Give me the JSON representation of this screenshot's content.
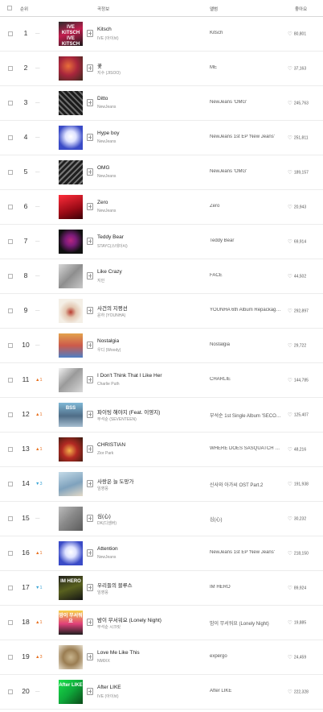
{
  "header": {
    "rank": "순위",
    "song_info": "곡정보",
    "album": "앨범",
    "like": "좋아요"
  },
  "rows": [
    {
      "rank": "1",
      "change": "—",
      "title": "Kitsch",
      "artist": "IVE (아이브)",
      "album": "Kitsch",
      "likes": "80,801",
      "cover_text": "IVE KITSCH IVE KITSCH IVE"
    },
    {
      "rank": "2",
      "change": "—",
      "title": "꽃",
      "artist": "지수 (JISOO)",
      "album": "ME",
      "likes": "37,163",
      "cover_text": ""
    },
    {
      "rank": "3",
      "change": "—",
      "title": "Ditto",
      "artist": "NewJeans",
      "album": "NewJeans 'OMG'",
      "likes": "245,763",
      "cover_text": ""
    },
    {
      "rank": "4",
      "change": "—",
      "title": "Hype boy",
      "artist": "NewJeans",
      "album": "NewJeans 1st EP 'New Jeans'",
      "likes": "251,811",
      "cover_text": ""
    },
    {
      "rank": "5",
      "change": "—",
      "title": "OMG",
      "artist": "NewJeans",
      "album": "NewJeans 'OMG'",
      "likes": "189,157",
      "cover_text": ""
    },
    {
      "rank": "6",
      "change": "—",
      "title": "Zero",
      "artist": "NewJeans",
      "album": "Zero",
      "likes": "20,943",
      "cover_text": ""
    },
    {
      "rank": "7",
      "change": "—",
      "title": "Teddy Bear",
      "artist": "STAYC(스테이씨)",
      "album": "Teddy Bear",
      "likes": "69,914",
      "cover_text": ""
    },
    {
      "rank": "8",
      "change": "—",
      "title": "Like Crazy",
      "artist": "지민",
      "album": "FACE",
      "likes": "44,502",
      "cover_text": ""
    },
    {
      "rank": "9",
      "change": "—",
      "title": "사건의 지평선",
      "artist": "윤하 (YOUNHA)",
      "album": "YOUNHA 6th Album Repackage 'END THEORY : Final Edition'",
      "likes": "292,897",
      "cover_text": ""
    },
    {
      "rank": "10",
      "change": "—",
      "title": "Nostalgia",
      "artist": "우디 (Woody)",
      "album": "Nostalgia",
      "likes": "29,722",
      "cover_text": ""
    },
    {
      "rank": "11",
      "change": "▲1",
      "dir": "up",
      "title": "I Don't Think That I Like Her",
      "artist": "Charlie Puth",
      "album": "CHARLIE",
      "likes": "144,785",
      "cover_text": ""
    },
    {
      "rank": "12",
      "change": "▲1",
      "dir": "up",
      "title": "파이팅 해야지 (Feat. 이영지)",
      "artist": "부석순 (SEVENTEEN)",
      "album": "부석순 1st Single Album 'SECOND WIND'",
      "likes": "125,407",
      "cover_text": "BSS"
    },
    {
      "rank": "13",
      "change": "▲1",
      "dir": "up",
      "title": "CHRISTIAN",
      "artist": "Zior Park",
      "album": "WHERE DOES SASQUATCH LIVE?",
      "likes": "48,216",
      "cover_text": ""
    },
    {
      "rank": "14",
      "change": "▼3",
      "dir": "down",
      "title": "사랑은 늘 도망가",
      "artist": "임영웅",
      "album": "신사와 아가씨 OST Part.2",
      "likes": "191,938",
      "cover_text": ""
    },
    {
      "rank": "15",
      "change": "—",
      "title": "심(心)",
      "artist": "DK(디셈버)",
      "album": "심(心)",
      "likes": "30,232",
      "cover_text": ""
    },
    {
      "rank": "16",
      "change": "▲1",
      "dir": "up",
      "title": "Attention",
      "artist": "NewJeans",
      "album": "NewJeans 1st EP 'New Jeans'",
      "likes": "218,150",
      "cover_text": ""
    },
    {
      "rank": "17",
      "change": "▼1",
      "dir": "down",
      "title": "우리들의 블루스",
      "artist": "임영웅",
      "album": "IM HERO",
      "likes": "89,924",
      "cover_text": "IM HERO"
    },
    {
      "rank": "18",
      "change": "▲1",
      "dir": "up",
      "title": "밤이 무서워요 (Lonely Night)",
      "artist": "부석순 시크릿",
      "album": "밤이 무서워요 (Lonely Night)",
      "likes": "19,885",
      "cover_text": "밤이 무서워요"
    },
    {
      "rank": "19",
      "change": "▲3",
      "dir": "up",
      "title": "Love Me Like This",
      "artist": "NMIXX",
      "album": "expérgo",
      "likes": "24,459",
      "cover_text": ""
    },
    {
      "rank": "20",
      "change": "—",
      "title": "After LIKE",
      "artist": "IVE (아이브)",
      "album": "After LIKE",
      "likes": "222,328",
      "cover_text": "After LIKE"
    }
  ],
  "colors": {
    "up": "#e8701e",
    "down": "#3fa6d6",
    "same": "#bbbbbb"
  },
  "icons": {
    "checkbox": "checkbox-icon",
    "info": "song-info-icon",
    "heart": "heart-icon"
  }
}
